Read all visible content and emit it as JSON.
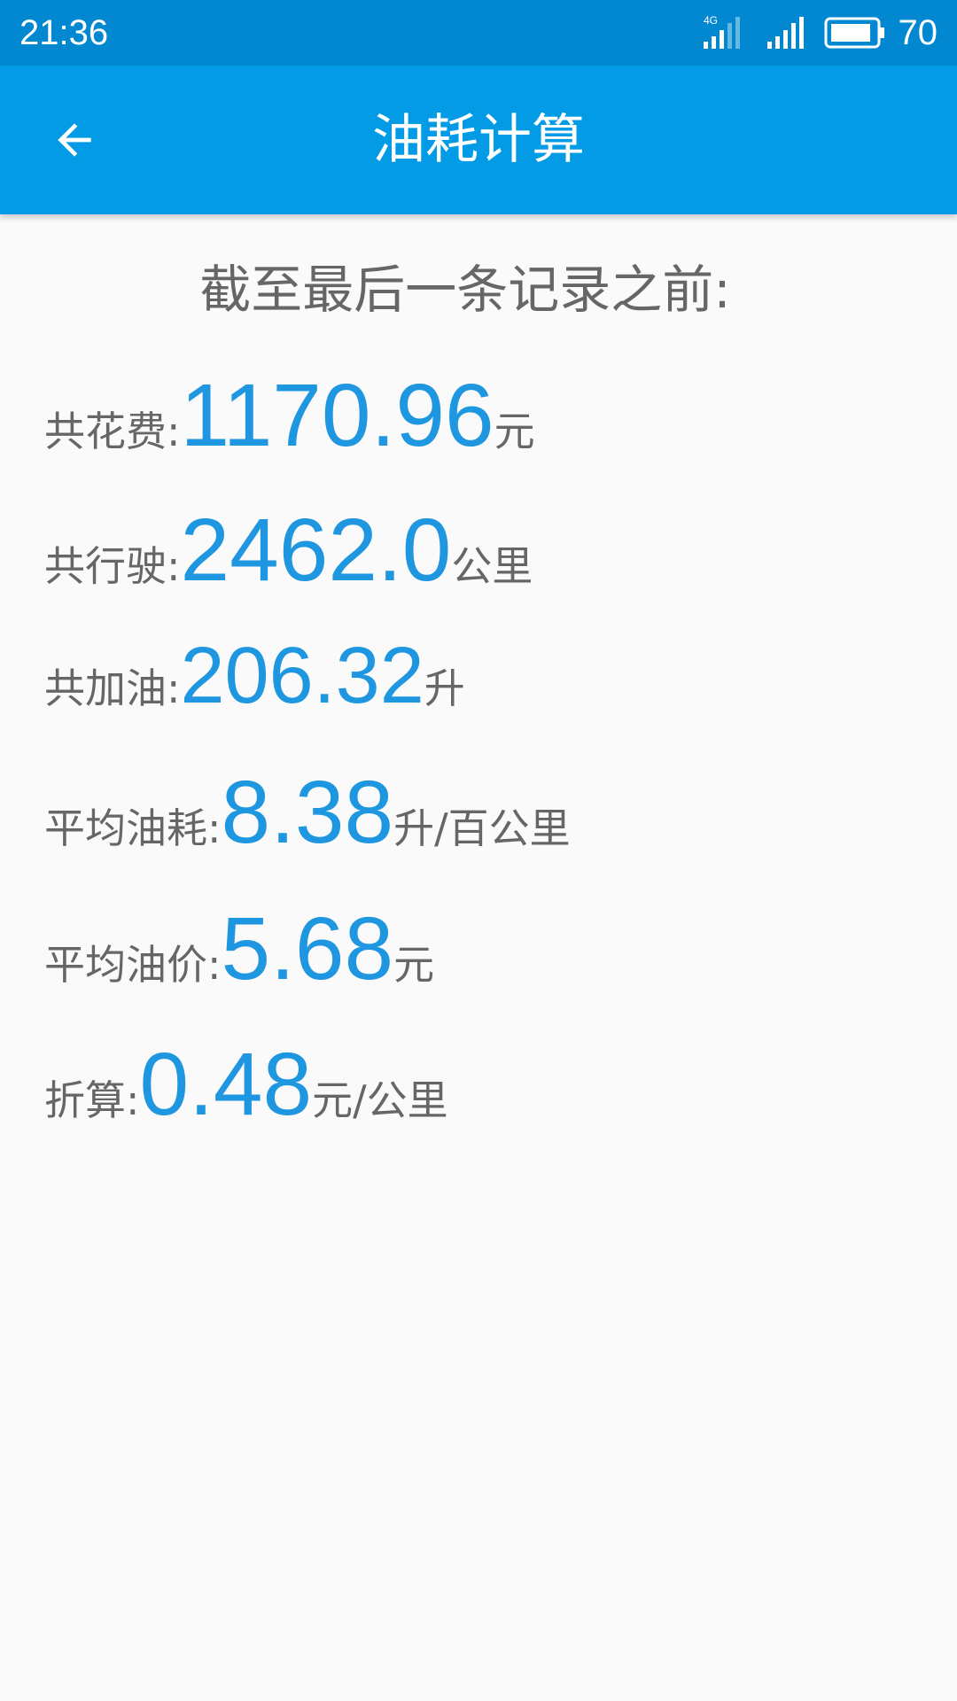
{
  "status_bar": {
    "time": "21:36",
    "network": "4G",
    "battery": "70",
    "icons": [
      "4g-signal-icon",
      "wifi-signal-icon",
      "battery-icon"
    ]
  },
  "app_bar": {
    "back_icon": "arrow-left-icon",
    "title": "油耗计算"
  },
  "summary": {
    "subtitle": "截至最后一条记录之前:",
    "rows": [
      {
        "label": "共花费:",
        "value": "1170.96",
        "unit": "元"
      },
      {
        "label": "共行驶:",
        "value": "2462.0",
        "unit": "公里"
      },
      {
        "label": "共加油:",
        "value": "206.32",
        "unit": "升"
      },
      {
        "label": "平均油耗:",
        "value": "8.38",
        "unit": "升/百公里"
      },
      {
        "label": "平均油价:",
        "value": "5.68",
        "unit": "元"
      },
      {
        "label": "折算:",
        "value": "0.48",
        "unit": "元/公里"
      }
    ]
  },
  "colors": {
    "status_bar": "#0288d1",
    "app_bar": "#039be5",
    "value_accent": "#1e96e0",
    "label_text": "#666666",
    "background": "#fafafa"
  }
}
